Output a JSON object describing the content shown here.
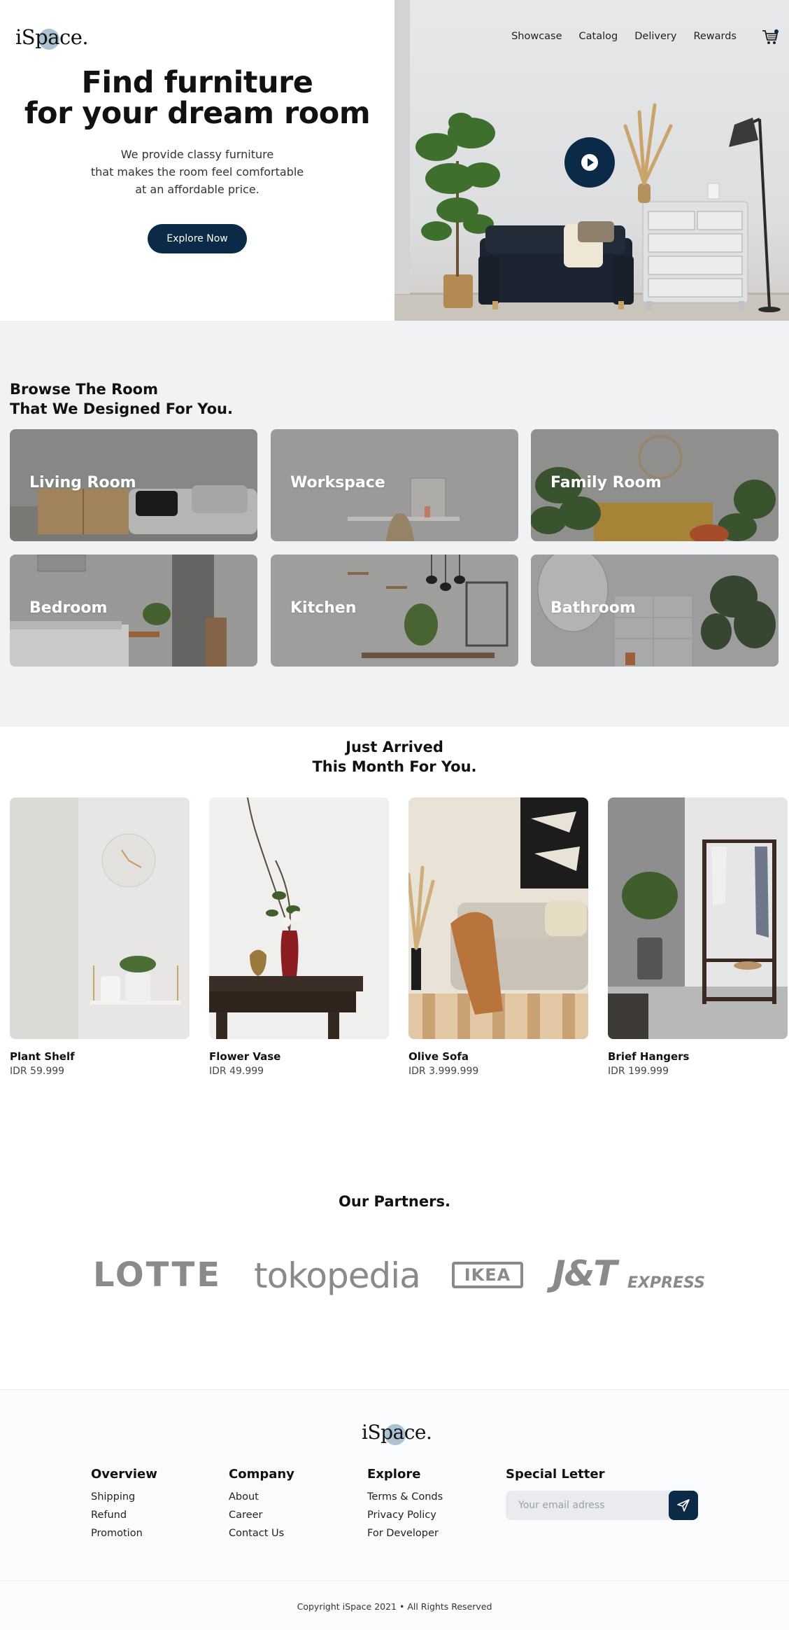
{
  "brand": {
    "logo_text": "iSpace."
  },
  "nav": {
    "items": [
      "Showcase",
      "Catalog",
      "Delivery",
      "Rewards"
    ],
    "cart_icon": "cart-icon"
  },
  "hero": {
    "title_line1": "Find furniture",
    "title_line2": "for your dream room",
    "desc_line1": "We provide classy furniture",
    "desc_line2": "that makes the room feel comfortable",
    "desc_line3": "at an affordable price.",
    "cta_label": "Explore Now",
    "play_icon": "play-icon"
  },
  "browse": {
    "heading_line1": "Browse The Room",
    "heading_line2": "That We Designed For You.",
    "rooms": [
      {
        "label": "Living Room"
      },
      {
        "label": "Workspace"
      },
      {
        "label": "Family Room"
      },
      {
        "label": "Bedroom"
      },
      {
        "label": "Kitchen"
      },
      {
        "label": "Bathroom"
      }
    ]
  },
  "arrived": {
    "heading_line1": "Just Arrived",
    "heading_line2": "This Month For You.",
    "products": [
      {
        "name": "Plant Shelf",
        "price": "IDR 59.999"
      },
      {
        "name": "Flower Vase",
        "price": "IDR 49.999"
      },
      {
        "name": "Olive Sofa",
        "price": "IDR 3.999.999"
      },
      {
        "name": "Brief Hangers",
        "price": "IDR 199.999"
      }
    ]
  },
  "partners": {
    "heading": "Our Partners.",
    "logos": [
      "LOTTE",
      "tokopedia",
      "IKEA",
      "J&T",
      "EXPRESS"
    ]
  },
  "footer": {
    "columns": [
      {
        "title": "Overview",
        "links": [
          "Shipping",
          "Refund",
          "Promotion"
        ]
      },
      {
        "title": "Company",
        "links": [
          "About",
          "Career",
          "Contact Us"
        ]
      },
      {
        "title": "Explore",
        "links": [
          "Terms & Conds",
          "Privacy Policy",
          "For Developer"
        ]
      }
    ],
    "newsletter_title": "Special Letter",
    "newsletter_placeholder": "Your email adress",
    "send_icon": "send-icon",
    "copyright": "Copyright iSpace 2021 • All Rights Reserved"
  },
  "colors": {
    "accent": "#0a2a47",
    "section_bg": "#f1f2f4"
  }
}
